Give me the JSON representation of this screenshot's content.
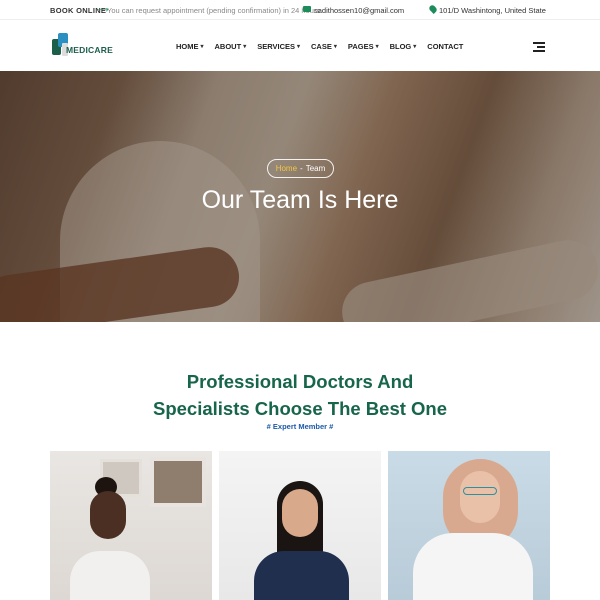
{
  "topbar": {
    "book_label": "BOOK ONLINE",
    "arrow": "⟶",
    "note": "You can request appointment (pending confirmation) in 24 hours",
    "email": "sadithossen10@gmail.com",
    "address": "101/D Washintong, United State"
  },
  "header": {
    "logo_text": "MEDICARE",
    "nav": [
      {
        "label": "HOME",
        "chevron": "▾"
      },
      {
        "label": "ABOUT",
        "chevron": "▾"
      },
      {
        "label": "SERVICES",
        "chevron": "▾"
      },
      {
        "label": "CASE",
        "chevron": "▾"
      },
      {
        "label": "PAGES",
        "chevron": "▾"
      },
      {
        "label": "BLOG",
        "chevron": "▾"
      },
      {
        "label": "CONTACT",
        "chevron": ""
      }
    ]
  },
  "hero": {
    "breadcrumb_home": "Home",
    "breadcrumb_sep": "-",
    "breadcrumb_current": "Team",
    "title": "Our Team Is Here"
  },
  "section": {
    "title_line1": "Professional Doctors And",
    "title_line2": "Specialists Choose The Best One",
    "tagline": "# Expert Member #"
  },
  "colors": {
    "brand_green": "#17654a",
    "accent_blue": "#1b5ba8",
    "breadcrumb_home": "#f2c744"
  },
  "icons": [
    "arrow-right-icon",
    "mail-icon",
    "map-pin-icon",
    "menu-icon",
    "chevron-down-icon"
  ]
}
